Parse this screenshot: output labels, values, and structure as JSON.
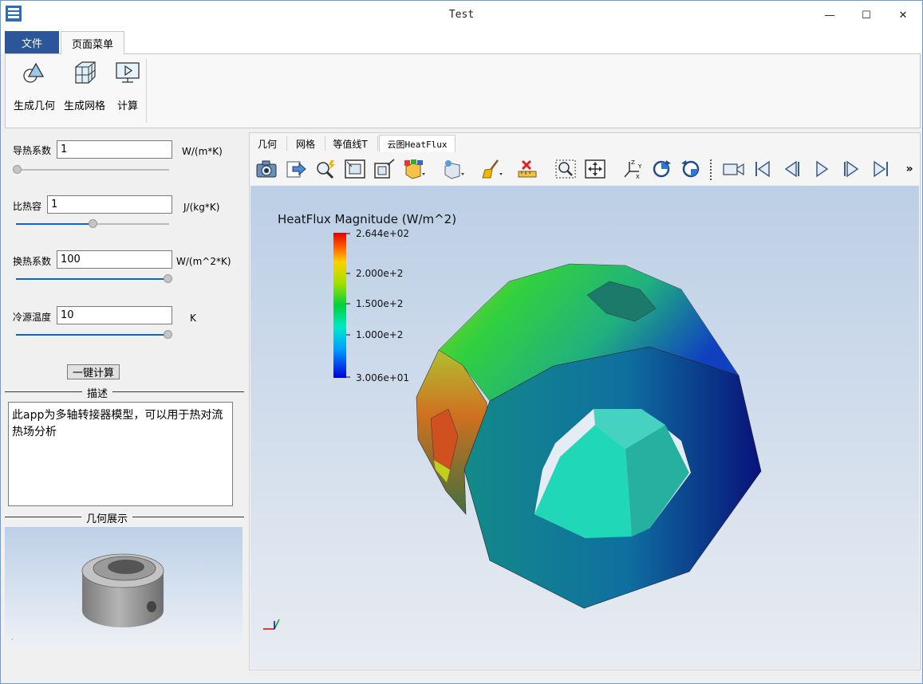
{
  "window": {
    "title": "Test"
  },
  "ribbon_tabs": {
    "file": "文件",
    "page_menu": "页面菜单"
  },
  "ribbon": {
    "gen_geometry": "生成几何",
    "gen_mesh": "生成网格",
    "compute": "计算"
  },
  "params": [
    {
      "label": "导热系数",
      "value": "1",
      "unit": "W/(m*K)",
      "slider_fraction": 0.0
    },
    {
      "label": "比热容",
      "value": "1",
      "unit": "J/(kg*K)",
      "slider_fraction": 0.5
    },
    {
      "label": "换热系数",
      "value": "100",
      "unit": "W/(m^2*K)",
      "slider_fraction": 1.0
    },
    {
      "label": "冷源温度",
      "value": "10",
      "unit": "K",
      "slider_fraction": 1.0
    }
  ],
  "calc_button": "一键计算",
  "description": {
    "title": "描述",
    "text": "此app为多轴转接器模型，可以用于热对流热场分析"
  },
  "geometry_group": {
    "title": "几何展示"
  },
  "view_tabs": [
    "几何",
    "网格",
    "等值线T",
    "云图HeatFlux"
  ],
  "colorbar": {
    "title": "HeatFlux Magnitude (W/m^2)",
    "ticks": [
      "2.644e+02",
      "2.000e+2",
      "1.500e+2",
      "1.000e+2",
      "3.006e+01"
    ],
    "colors": [
      "#0000d8",
      "#00a0ff",
      "#00e8c8",
      "#00d040",
      "#a0e000",
      "#ffd000",
      "#ff6000",
      "#e00000"
    ]
  },
  "toolbar_icons": [
    "camera-icon",
    "export-icon",
    "magic-zoom-icon",
    "zoom-box-icon",
    "resize-icon",
    "box-color-icon",
    "box-light-icon",
    "brush-icon",
    "ruler-delete-icon",
    "zoom-select-icon",
    "fit-view-icon",
    "axes-icon",
    "rotate-cw-icon",
    "rotate-ccw-icon",
    "video-camera-icon",
    "first-frame-icon",
    "prev-frame-icon",
    "play-icon",
    "next-frame-icon",
    "last-frame-icon",
    "more-icon"
  ],
  "colors": {
    "accent": "#2b579a",
    "slider": "#0a68c4"
  }
}
